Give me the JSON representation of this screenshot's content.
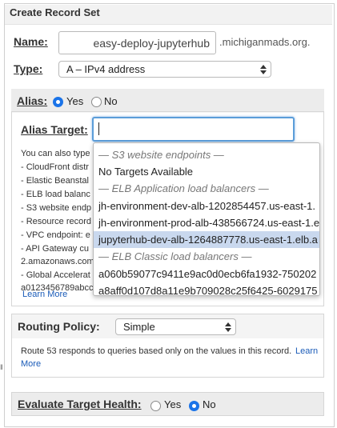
{
  "header": {
    "title": "Create Record Set"
  },
  "name_field": {
    "label": "Name:",
    "value": "easy-deploy-jupyterhub",
    "suffix": ".michiganmads.org."
  },
  "type_field": {
    "label": "Type:",
    "value": "A – IPv4 address"
  },
  "alias": {
    "label": "Alias:",
    "yes": "Yes",
    "no": "No",
    "selected": "Yes"
  },
  "alias_target": {
    "label": "Alias Target:",
    "value": "",
    "help_lines": [
      "You can also type",
      "-  CloudFront distr",
      "-  Elastic Beanstal",
      "-  ELB load balanc",
      "-  S3 website endp",
      "-  Resource record",
      "-  VPC endpoint: e",
      "-  API Gateway cu",
      "2.amazonaws.com",
      "-  Global Accelerat",
      "a0123456789abcc"
    ],
    "learn_more": "Learn More"
  },
  "dropdown": {
    "items": [
      {
        "text": "— S3 website endpoints —",
        "kind": "group"
      },
      {
        "text": "No Targets Available",
        "kind": "item"
      },
      {
        "text": "— ELB Application load balancers —",
        "kind": "group"
      },
      {
        "text": "jh-environment-dev-alb-1202854457.us-east-1.",
        "kind": "item"
      },
      {
        "text": "jh-environment-prod-alb-438566724.us-east-1.e",
        "kind": "item"
      },
      {
        "text": "jupyterhub-dev-alb-1264887778.us-east-1.elb.a",
        "kind": "highlighted"
      },
      {
        "text": "— ELB Classic load balancers —",
        "kind": "group"
      },
      {
        "text": "a060b59077c9411e9ac0d0ecb6fa1932-750202",
        "kind": "item"
      },
      {
        "text": "a8aff0d107d8a11e9b709028c25f6425-6029175",
        "kind": "item"
      }
    ]
  },
  "routing_policy": {
    "label": "Routing Policy:",
    "value": "Simple",
    "description": "Route 53 responds to queries based only on the values in this record.",
    "learn_more_part1": "Learn",
    "learn_more_part2": "More"
  },
  "evaluate_target_health": {
    "label": "Evaluate Target Health:",
    "yes": "Yes",
    "no": "No",
    "selected": "No"
  },
  "colors": {
    "accent": "#1a73e8",
    "highlight": "#c9d8ee",
    "link": "#1a5bb8"
  }
}
